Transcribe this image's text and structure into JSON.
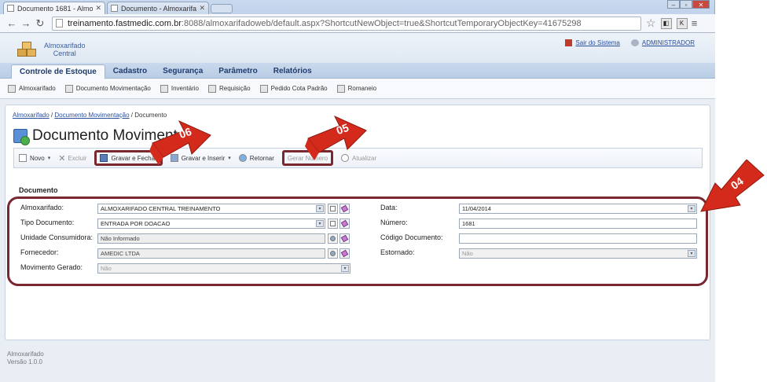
{
  "browser": {
    "tabs": [
      {
        "label": "Documento 1681 - Almox",
        "active": true
      },
      {
        "label": "Documento - Almoxarifad",
        "active": false
      }
    ],
    "url_host": "treinamento.fastmedic.com.br",
    "url_rest": ":8088/almoxarifadoweb/default.aspx?ShortcutNewObject=true&ShortcutTemporaryObjectKey=41675298"
  },
  "app": {
    "name_line1": "Almoxarifado",
    "name_line2": "Central",
    "logout_label": "Sair do Sistema",
    "user_label": "ADMINISTRADOR"
  },
  "menu": {
    "items": [
      {
        "label": "Controle de Estoque",
        "active": true
      },
      {
        "label": "Cadastro",
        "active": false
      },
      {
        "label": "Segurança",
        "active": false
      },
      {
        "label": "Parâmetro",
        "active": false
      },
      {
        "label": "Relatórios",
        "active": false
      }
    ]
  },
  "submenu": {
    "items": [
      "Almoxarifado",
      "Documento Movimentação",
      "Inventário",
      "Requisição",
      "Pedido Cota Padrão",
      "Romaneio"
    ]
  },
  "breadcrumb": {
    "part1": "Almoxarifado",
    "sep": "/",
    "part2": "Documento Movimentação",
    "part3": "Documento"
  },
  "page": {
    "title": "Documento Moviment"
  },
  "toolbar": {
    "novo": "Novo",
    "excluir": "Excluir",
    "gravar_fechar": "Gravar e Fechar",
    "gravar_inserir": "Gravar e Inserir",
    "retornar": "Retornar",
    "gerar_numero": "Gerar Número",
    "atualizar": "Atualizar"
  },
  "form": {
    "section_title": "Documento",
    "almoxarifado_label": "Almoxarifado:",
    "almoxarifado_value": "ALMOXARIFADO CENTRAL TREINAMENTO",
    "tipo_label": "Tipo Documento:",
    "tipo_value": "ENTRADA POR DOACAO",
    "unidade_label": "Unidade Consumidora:",
    "unidade_value": "Não Informado",
    "fornecedor_label": "Fornecedor:",
    "fornecedor_value": "AMEDIC LTDA",
    "movimento_label": "Movimento Gerado:",
    "movimento_value": "Não",
    "data_label": "Data:",
    "data_value": "11/04/2014",
    "numero_label": "Número:",
    "numero_value": "1681",
    "codigo_label": "Código Documento:",
    "codigo_value": "",
    "estornado_label": "Estornado:",
    "estornado_value": "Não"
  },
  "footer": {
    "line1": "Almoxarifado",
    "line2": "Versão 1.0.0"
  },
  "annotations": {
    "a06": "06",
    "a05": "05",
    "a04": "04",
    "color": "#d32a1c"
  }
}
